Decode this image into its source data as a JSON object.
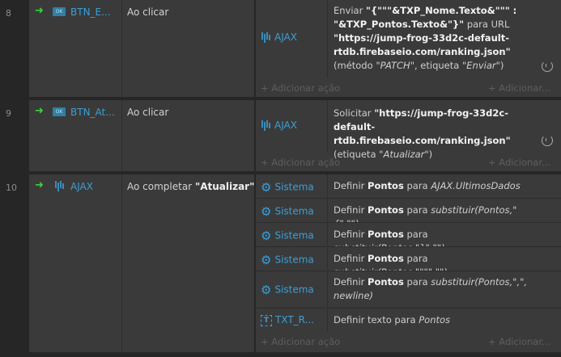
{
  "events": [
    {
      "number": "8",
      "object": "BTN_E...",
      "trigger": "Ao clicar",
      "trigger_bold": "",
      "actions": [
        {
          "object": "AJAX",
          "icon": "ajax-icon",
          "text_html": "Enviar <b>\"{\"\"\"&TXP_Nome.Texto&\"\"\" : \"&TXP_Pontos.Texto&\"}\"</b> para URL <b>\"https://jump-frog-33d2c-default-rtdb.firebaseio.com/ranking.json\"</b> (método <i>\"PATCH\"</i>, etiqueta <i>\"Enviar\"</i>)",
          "has_refresh": true
        }
      ],
      "add_action_left": "+ Adicionar ação",
      "add_action_right": "+ Adicionar..."
    },
    {
      "number": "9",
      "object": "BTN_At...",
      "trigger": "Ao clicar",
      "trigger_bold": "",
      "actions": [
        {
          "object": "AJAX",
          "icon": "ajax-icon",
          "text_html": "Solicitar <b>\"https://jump-frog-33d2c-default-rtdb.firebaseio.com/ranking.json\"</b> (etiqueta <i>\"Atualizar\"</i>)",
          "has_refresh": true
        }
      ],
      "add_action_left": "+ Adicionar ação",
      "add_action_right": "+ Adicionar..."
    },
    {
      "number": "10",
      "object": "AJAX",
      "trigger": "Ao completar",
      "trigger_bold": "\"Atualizar\"",
      "actions": [
        {
          "object": "Sistema",
          "icon": "gear-icon",
          "text_html": "Definir <b>Pontos</b> para <i>AJAX.UltimosDados</i>"
        },
        {
          "object": "Sistema",
          "icon": "gear-icon",
          "text_html": "Definir <b>Pontos</b> para <i>substituir(Pontos,\"{\",\"\")</i>"
        },
        {
          "object": "Sistema",
          "icon": "gear-icon",
          "text_html": "Definir <b>Pontos</b> para <i>substituir(Pontos,\"}\",\"\")</i>"
        },
        {
          "object": "Sistema",
          "icon": "gear-icon",
          "text_html": "Definir <b>Pontos</b> para <i>substituir(Pontos,\"\"\"\",\"\")</i>"
        },
        {
          "object": "Sistema",
          "icon": "gear-icon",
          "text_html": "Definir <b>Pontos</b> para <i>substituir(Pontos,\",\", newline)</i>"
        },
        {
          "object": "TXT_R...",
          "icon": "text-object-icon",
          "text_html": "Definir texto para <i>Pontos</i>"
        }
      ],
      "add_action_left": "+ Adicionar ação",
      "add_action_right": "+ Adicionar..."
    }
  ]
}
